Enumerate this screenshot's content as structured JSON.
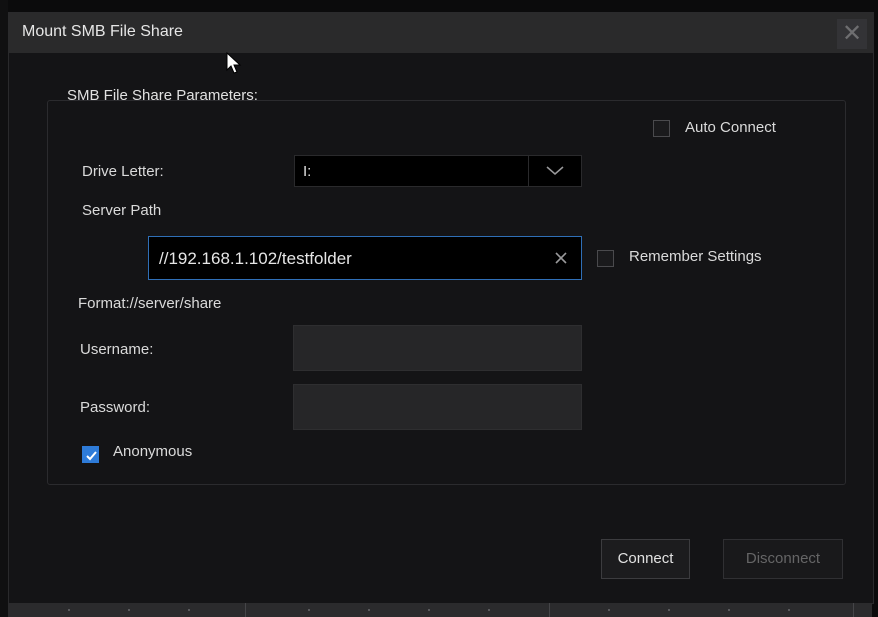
{
  "dialog": {
    "title": "Mount SMB File Share",
    "close_icon": "close-icon"
  },
  "group": {
    "label": "SMB File Share Parameters:"
  },
  "auto_connect": {
    "label": "Auto Connect",
    "checked": false
  },
  "drive_letter": {
    "label": "Drive Letter:",
    "value": "I:",
    "icon": "chevron-down-icon"
  },
  "server_path": {
    "label": "Server Path",
    "value": "//192.168.1.102/testfolder",
    "clear_icon": "clear-icon",
    "format_hint": "Format://server/share"
  },
  "remember_settings": {
    "label": "Remember Settings",
    "checked": false
  },
  "username": {
    "label": "Username:",
    "value": ""
  },
  "password": {
    "label": "Password:",
    "value": ""
  },
  "anonymous": {
    "label": "Anonymous",
    "checked": true
  },
  "buttons": {
    "connect": "Connect",
    "disconnect": "Disconnect"
  },
  "colors": {
    "accent": "#2e7bd8",
    "background": "#141416",
    "titlebar": "#2a2a2b"
  }
}
